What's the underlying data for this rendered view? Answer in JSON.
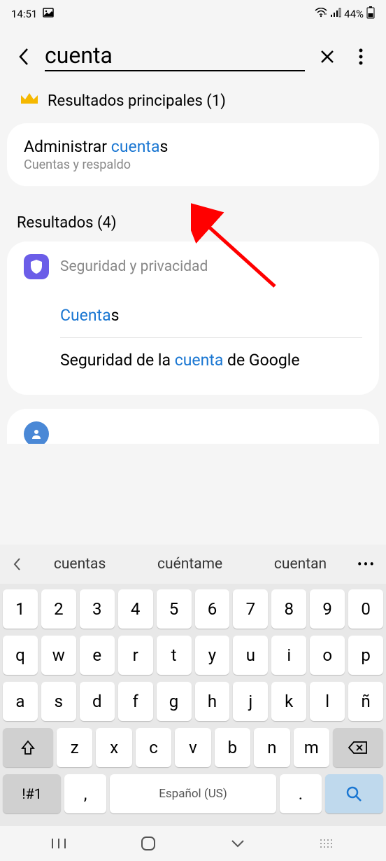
{
  "status": {
    "time": "14:51",
    "battery": "44%"
  },
  "search": {
    "query": "cuenta"
  },
  "topResults": {
    "header": "Resultados principales (1)",
    "item": {
      "title_prefix": "Administrar ",
      "title_highlight": "cuenta",
      "title_suffix": "s",
      "subtitle": "Cuentas y respaldo"
    }
  },
  "results": {
    "header": "Resultados (4)",
    "category1": {
      "name": "Seguridad y privacidad",
      "items": [
        {
          "prefix": "",
          "highlight": "Cuenta",
          "suffix": "s"
        },
        {
          "prefix": "Seguridad de la ",
          "highlight": "cuenta",
          "suffix": " de Google"
        }
      ]
    }
  },
  "keyboard": {
    "suggestions": [
      "cuentas",
      "cuéntame",
      "cuentan"
    ],
    "row1": [
      "1",
      "2",
      "3",
      "4",
      "5",
      "6",
      "7",
      "8",
      "9",
      "0"
    ],
    "row2": [
      "q",
      "w",
      "e",
      "r",
      "t",
      "y",
      "u",
      "i",
      "o",
      "p"
    ],
    "row3": [
      "a",
      "s",
      "d",
      "f",
      "g",
      "h",
      "j",
      "k",
      "l",
      "ñ"
    ],
    "row4": [
      "z",
      "x",
      "c",
      "v",
      "b",
      "n",
      "m"
    ],
    "special": "!#1",
    "comma": ",",
    "space": "Español (US)",
    "period": "."
  }
}
